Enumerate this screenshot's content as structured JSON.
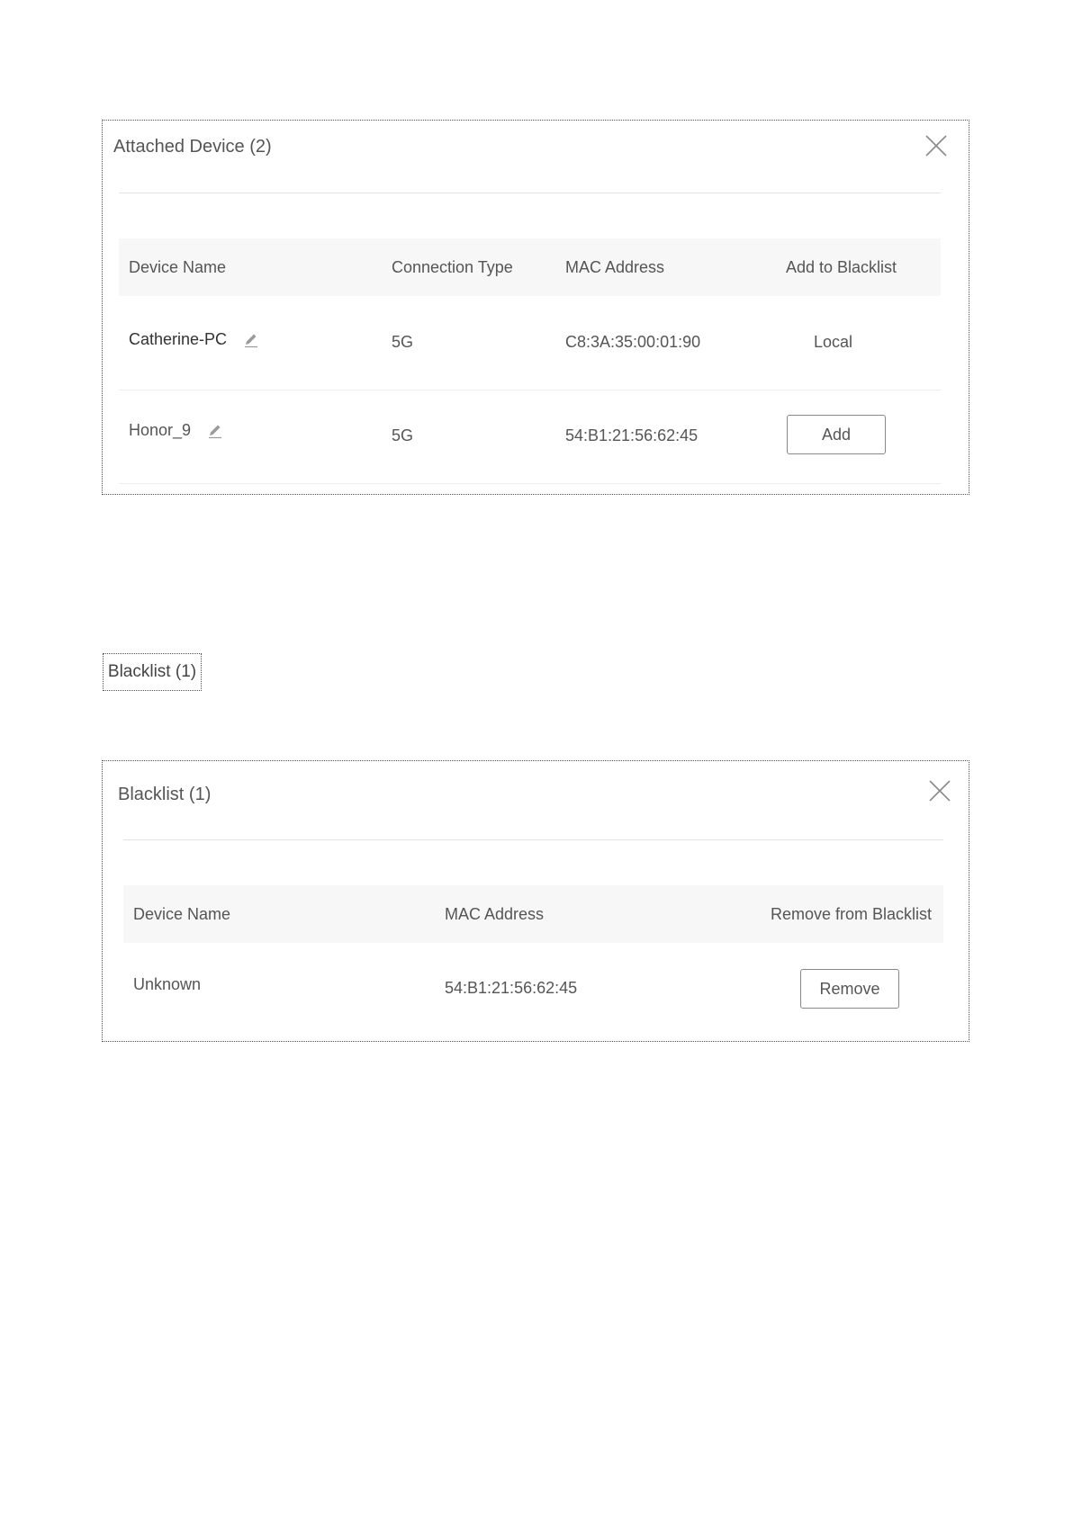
{
  "attached_panel": {
    "title": "Attached Device (2)",
    "close_icon": "close-icon",
    "headers": {
      "device_name": "Device Name",
      "connection_type": "Connection Type",
      "mac_address": "MAC Address",
      "add_to_blacklist": "Add to Blacklist"
    },
    "rows": [
      {
        "name": "Catherine-PC",
        "edit_icon": "pencil-icon",
        "connection": "5G",
        "mac": "C8:3A:35:00:01:90",
        "action_text": "Local"
      },
      {
        "name": "Honor_9",
        "edit_icon": "pencil-icon",
        "connection": "5G",
        "mac": "54:B1:21:56:62:45",
        "action_button": "Add"
      }
    ]
  },
  "blacklist_link": {
    "label": "Blacklist (1)"
  },
  "blacklist_panel": {
    "title": "Blacklist (1)",
    "close_icon": "close-icon",
    "headers": {
      "device_name": "Device Name",
      "mac_address": "MAC Address",
      "remove_from_blacklist": "Remove from Blacklist"
    },
    "rows": [
      {
        "name": "Unknown",
        "mac": "54:B1:21:56:62:45",
        "action_button": "Remove"
      }
    ]
  }
}
